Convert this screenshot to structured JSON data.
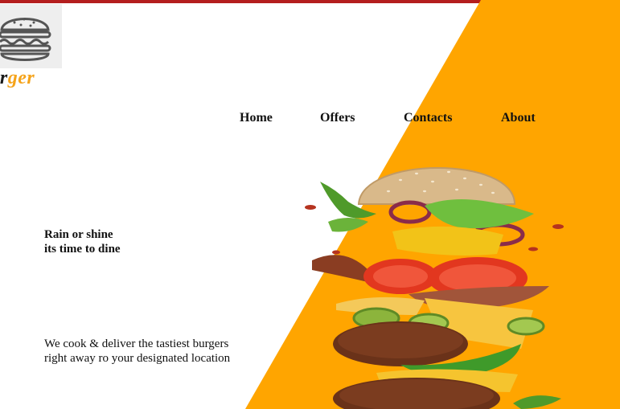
{
  "brand": {
    "part1": "ur",
    "part2": "ger",
    "logo_icon": "burger-outline-icon"
  },
  "nav": {
    "home": "Home",
    "offers": "Offers",
    "contacts": "Contacts",
    "about": "About"
  },
  "hero": {
    "tagline_line1": "Rain or shine",
    "tagline_line2": "its time to dine",
    "desc_line1": "We cook & deliver the tastiest burgers",
    "desc_line2": "right away ro your designated location",
    "image": "burger-image"
  },
  "colors": {
    "accent": "#ffa500",
    "top_bar": "#b41e1e",
    "brand_highlight": "#f5a31a"
  }
}
